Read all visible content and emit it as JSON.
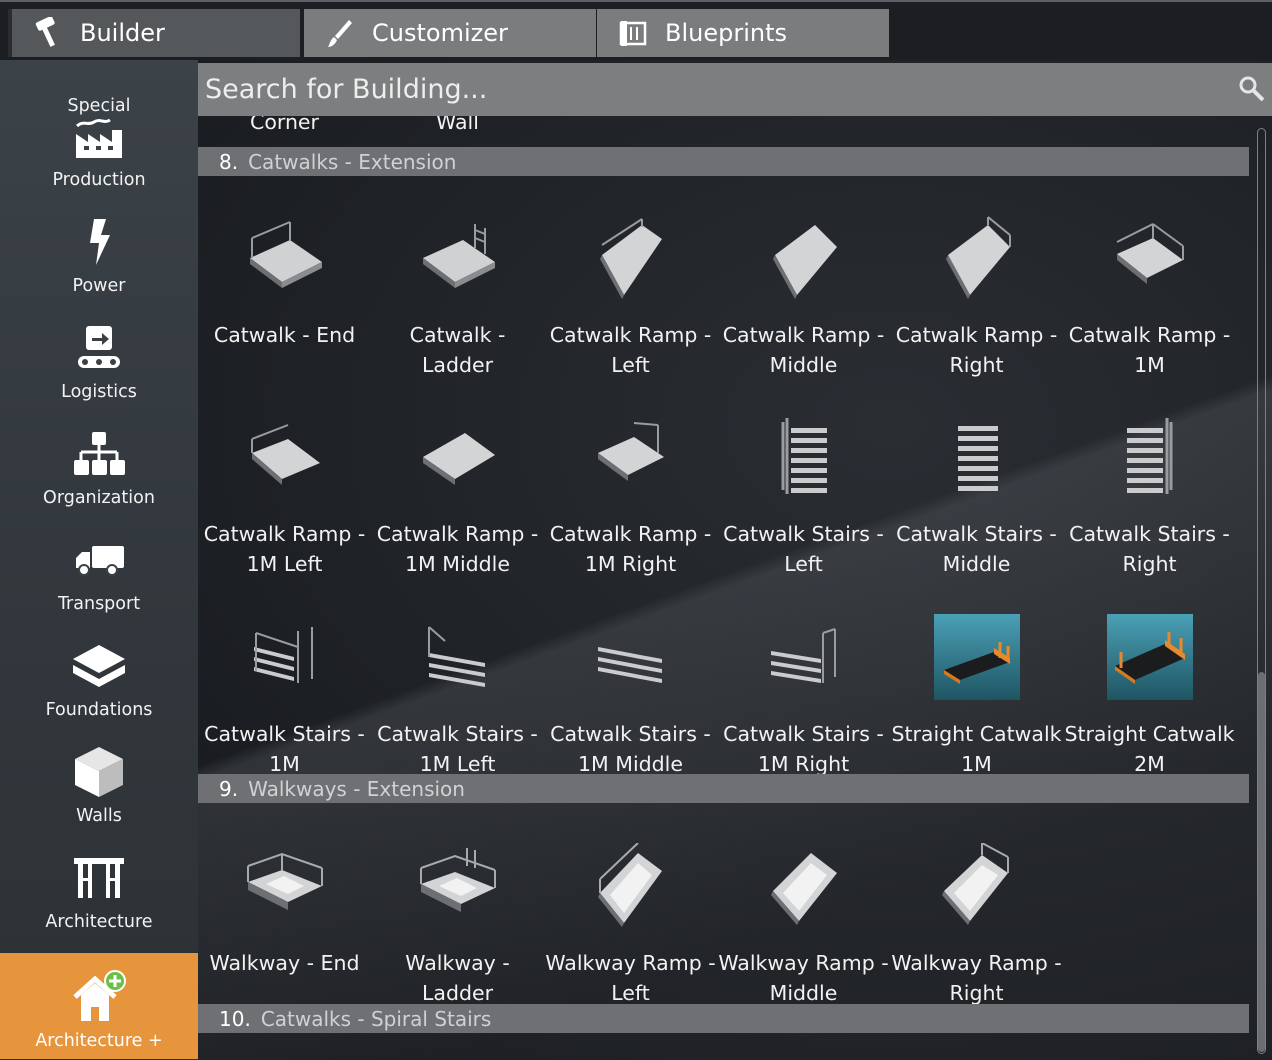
{
  "tabs": [
    {
      "label": "Builder",
      "icon": "hammer-icon",
      "active": true
    },
    {
      "label": "Customizer",
      "icon": "brush-icon",
      "active": false
    },
    {
      "label": "Blueprints",
      "icon": "blueprint-icon",
      "active": false
    }
  ],
  "sidebar": {
    "items": [
      {
        "label": "Special",
        "icon": "special-icon"
      },
      {
        "label": "Production",
        "icon": "factory-icon"
      },
      {
        "label": "Power",
        "icon": "lightning-icon"
      },
      {
        "label": "Logistics",
        "icon": "conveyor-icon"
      },
      {
        "label": "Organization",
        "icon": "hierarchy-icon"
      },
      {
        "label": "Transport",
        "icon": "truck-icon"
      },
      {
        "label": "Foundations",
        "icon": "foundation-icon"
      },
      {
        "label": "Walls",
        "icon": "wall-cube-icon"
      },
      {
        "label": "Architecture",
        "icon": "scaffold-icon"
      },
      {
        "label": "Architecture +",
        "icon": "house-plus-icon",
        "active": true
      }
    ]
  },
  "search": {
    "placeholder": "Search for Building..."
  },
  "partial_row": [
    "Corner",
    "Wall"
  ],
  "sections": [
    {
      "number": "8.",
      "title": "Catwalks - Extension",
      "items": [
        {
          "name": "Catwalk - End",
          "icon": "catwalk-end-icon"
        },
        {
          "name": "Catwalk - Ladder",
          "icon": "catwalk-ladder-icon"
        },
        {
          "name": "Catwalk Ramp - Left",
          "icon": "catwalk-ramp-left-icon"
        },
        {
          "name": "Catwalk Ramp - Middle",
          "icon": "catwalk-ramp-middle-icon"
        },
        {
          "name": "Catwalk Ramp - Right",
          "icon": "catwalk-ramp-right-icon"
        },
        {
          "name": "Catwalk Ramp - 1M",
          "icon": "catwalk-ramp-1m-icon"
        },
        {
          "name": "Catwalk Ramp - 1M Left",
          "icon": "catwalk-ramp-1m-left-icon"
        },
        {
          "name": "Catwalk Ramp - 1M Middle",
          "icon": "catwalk-ramp-1m-middle-icon"
        },
        {
          "name": "Catwalk Ramp - 1M Right",
          "icon": "catwalk-ramp-1m-right-icon"
        },
        {
          "name": "Catwalk Stairs - Left",
          "icon": "catwalk-stairs-left-icon"
        },
        {
          "name": "Catwalk Stairs - Middle",
          "icon": "catwalk-stairs-middle-icon"
        },
        {
          "name": "Catwalk Stairs - Right",
          "icon": "catwalk-stairs-right-icon"
        },
        {
          "name": "Catwalk Stairs - 1M",
          "icon": "catwalk-stairs-1m-icon"
        },
        {
          "name": "Catwalk Stairs - 1M Left",
          "icon": "catwalk-stairs-1m-left-icon"
        },
        {
          "name": "Catwalk Stairs - 1M Middle",
          "icon": "catwalk-stairs-1m-middle-icon"
        },
        {
          "name": "Catwalk Stairs - 1M Right",
          "icon": "catwalk-stairs-1m-right-icon"
        },
        {
          "name": "Straight Catwalk 1M",
          "icon": "straight-catwalk-1m-icon"
        },
        {
          "name": "Straight Catwalk 2M",
          "icon": "straight-catwalk-2m-icon"
        }
      ]
    },
    {
      "number": "9.",
      "title": "Walkways - Extension",
      "items": [
        {
          "name": "Walkway - End",
          "icon": "walkway-end-icon"
        },
        {
          "name": "Walkway - Ladder",
          "icon": "walkway-ladder-icon"
        },
        {
          "name": "Walkway Ramp - Left",
          "icon": "walkway-ramp-left-icon"
        },
        {
          "name": "Walkway Ramp - Middle",
          "icon": "walkway-ramp-middle-icon"
        },
        {
          "name": "Walkway Ramp - Right",
          "icon": "walkway-ramp-right-icon"
        }
      ]
    },
    {
      "number": "10.",
      "title": "Catwalks - Spiral Stairs",
      "items": []
    }
  ],
  "colors": {
    "active_sidebar": "#e7953d",
    "section_bar": "#6e7073",
    "tab_inactive": "#7a7c7e",
    "tab_active": "#55585b",
    "search_bg": "#7c7e80"
  }
}
